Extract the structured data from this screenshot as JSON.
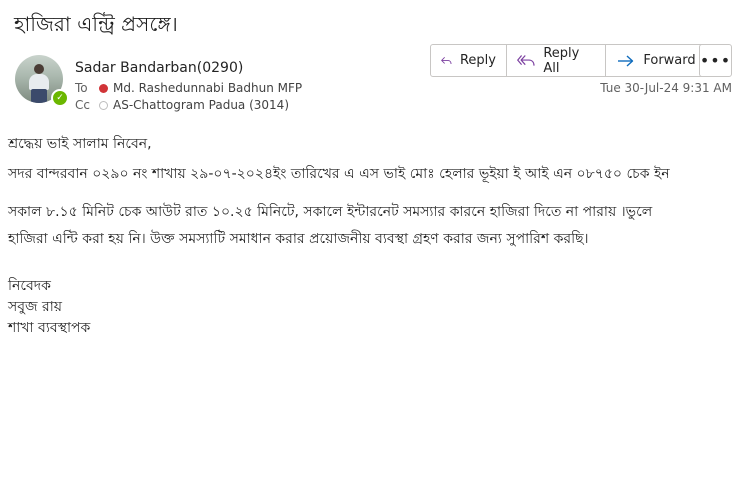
{
  "subject": "হাজিরা এন্ট্রি প্রসঙ্গে।",
  "sender": {
    "name": "Sadar Bandarban(0290)"
  },
  "to": {
    "label": "To",
    "name": "Md. Rashedunnabi Badhun MFP"
  },
  "cc": {
    "label": "Cc",
    "name": "AS-Chattogram Padua  (3014)"
  },
  "actions": {
    "reply": "Reply",
    "reply_all": "Reply All",
    "forward": "Forward",
    "more": "•••"
  },
  "date": "Tue 30-Jul-24 9:31 AM",
  "icons": {
    "reply": "reply-icon",
    "reply_all": "reply-all-icon",
    "forward": "forward-icon",
    "more": "more-icon"
  },
  "colors": {
    "accent": "#7b3fa0",
    "forward": "#0f6cbd",
    "presence": "#6bb700",
    "to_dot": "#d13438"
  },
  "body": {
    "greeting": "শ্রদ্ধেয় ভাই সালাম নিবেন,",
    "line1": "সদর বান্দরবান ০২৯০ নং শাখায়  ২৯-০৭-২০২৪ইং তারিখের এ এস ভাই মোঃ হেলার ভূইয়া  ই আই এন ০৮৭৫০ চেক ইন",
    "line2": "সকাল ৮.১৫  মিনিট চেক আউট রাত ১০.২৫ মিনিটে, সকালে ইন্টারনেট সমস্যার কারনে হাজিরা দিতে না পারায়  ।ভুলে",
    "line3": "হাজিরা এন্টি করা হয় নি। উক্ত সমস্যাটি সমাধান করার প্রয়োজনীয় ব্যবস্থা গ্রহণ করার জন্য সুপারিশ করছি।",
    "sign1": "নিবেদক",
    "sign2": "সবুজ  রায়",
    "sign3": "শাখা  ব্যবস্থাপক"
  }
}
